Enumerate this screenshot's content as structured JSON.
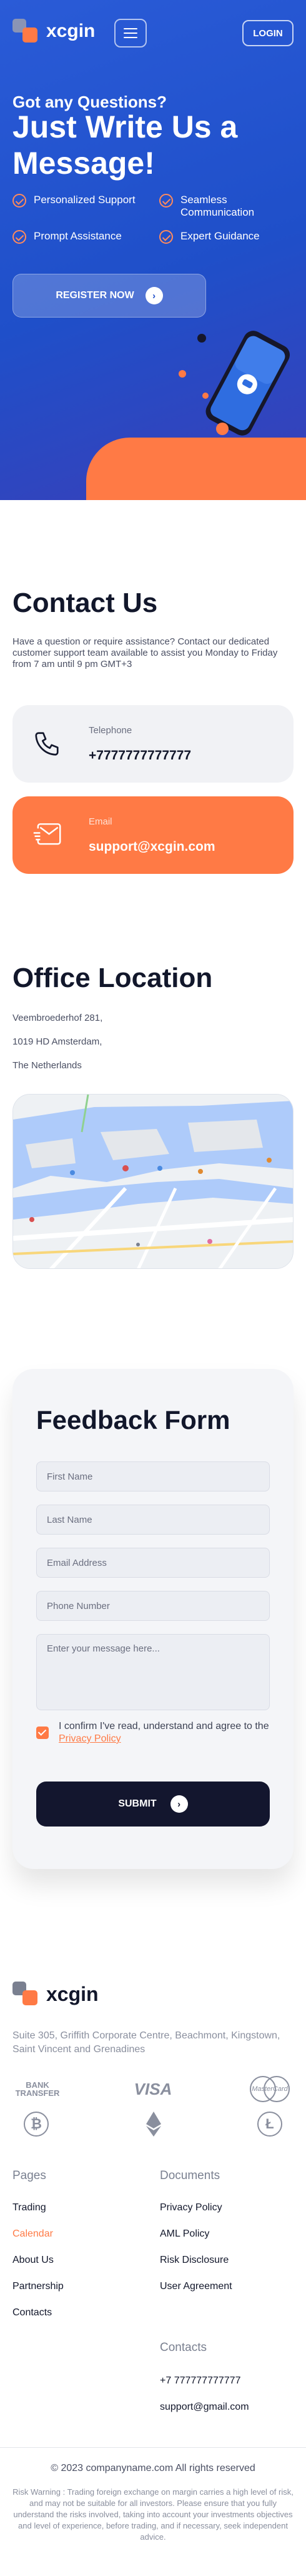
{
  "brand": {
    "name": "xcgin"
  },
  "nav": {
    "login_label": "LOGIN"
  },
  "hero": {
    "subtitle": "Got any Questions?",
    "title": "Just Write Us a Message!",
    "features": [
      "Personalized Support",
      "Seamless Communication",
      "Prompt Assistance",
      "Expert Guidance"
    ],
    "register_label": "REGISTER NOW"
  },
  "contact": {
    "title": "Contact Us",
    "description": "Have a question or require assistance? Contact our dedicated customer support team available to assist you Monday to Friday from 7 am until 9 pm GMT+3",
    "telephone_label": "Telephone",
    "telephone_value": "+7777777777777",
    "email_label": "Email",
    "email_value": "support@xcgin.com"
  },
  "office": {
    "title": "Office Location",
    "address_lines": [
      "Veembroederhof 281,",
      "1019 HD Amsterdam,",
      "The Netherlands"
    ]
  },
  "feedback": {
    "title": "Feedback Form",
    "first_name_placeholder": "First Name",
    "last_name_placeholder": "Last Name",
    "email_placeholder": "Email Address",
    "phone_placeholder": "Phone Number",
    "message_placeholder": "Enter your message here...",
    "confirm_text": "I confirm I've read, understand and agree to the",
    "privacy_link": "Privacy Policy",
    "submit_label": "SUBMIT"
  },
  "footer": {
    "address": "Suite 305, Griffith Corporate Centre, Beachmont, Kingstown, Saint Vincent and Grenadines",
    "payments": {
      "bank_transfer_line1": "BANK",
      "bank_transfer_line2": "TRANSFER",
      "visa": "VISA",
      "mastercard": "MasterCard"
    },
    "pages_heading": "Pages",
    "pages": [
      "Trading",
      "Calendar",
      "About Us",
      "Partnership",
      "Contacts"
    ],
    "documents_heading": "Documents",
    "documents": [
      "Privacy Policy",
      "AML Policy",
      "Risk Disclosure",
      "User Agreement"
    ],
    "contacts_heading": "Contacts",
    "contact_phone": "+7 777777777777",
    "contact_email": "support@gmail.com",
    "copyright": "© 2023 companyname.com All rights reserved",
    "risk_warning": "Risk Warning : Trading foreign exchange on margin carries a high level of risk, and may not be suitable for all investors. Please ensure that you fully understand the risks involved, taking into account your investments objectives and level of experience, before trading, and if necessary, seek independent advice."
  },
  "colors": {
    "accent": "#ff7a45",
    "hero_blue": "#1f4fc9",
    "dark": "#13162e"
  },
  "icons": [
    "menu-icon",
    "check-circle-icon",
    "arrow-right-icon",
    "chat-bubble-icon",
    "phone-icon",
    "mail-icon",
    "bitcoin-icon",
    "ethereum-icon",
    "litecoin-icon"
  ]
}
